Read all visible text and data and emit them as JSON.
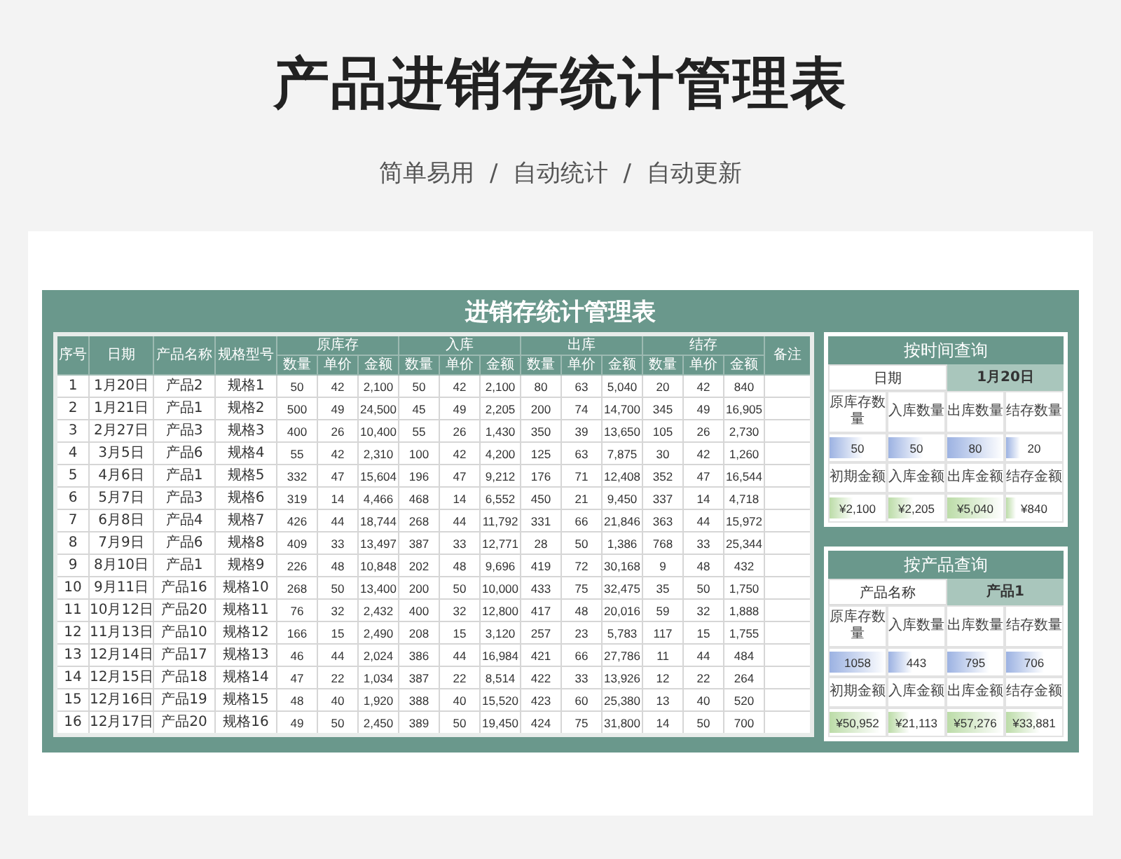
{
  "title": "产品进销存统计管理表",
  "subtitle": "简单易用  /  自动统计  /  自动更新",
  "sheet": {
    "title": "进销存统计管理表",
    "columns": [
      "序号",
      "日期",
      "产品名称",
      "规格型号"
    ],
    "groups": [
      {
        "label": "原库存",
        "sub": [
          "数量",
          "单价",
          "金额"
        ]
      },
      {
        "label": "入库",
        "sub": [
          "数量",
          "单价",
          "金额"
        ]
      },
      {
        "label": "出库",
        "sub": [
          "数量",
          "单价",
          "金额"
        ]
      },
      {
        "label": "结存",
        "sub": [
          "数量",
          "单价",
          "金额"
        ]
      }
    ],
    "note_column": "备注",
    "rows": [
      [
        "1",
        "1月20日",
        "产品2",
        "规格1",
        "50",
        "42",
        "2,100",
        "50",
        "42",
        "2,100",
        "80",
        "63",
        "5,040",
        "20",
        "42",
        "840"
      ],
      [
        "2",
        "1月21日",
        "产品1",
        "规格2",
        "500",
        "49",
        "24,500",
        "45",
        "49",
        "2,205",
        "200",
        "74",
        "14,700",
        "345",
        "49",
        "16,905"
      ],
      [
        "3",
        "2月27日",
        "产品3",
        "规格3",
        "400",
        "26",
        "10,400",
        "55",
        "26",
        "1,430",
        "350",
        "39",
        "13,650",
        "105",
        "26",
        "2,730"
      ],
      [
        "4",
        "3月5日",
        "产品6",
        "规格4",
        "55",
        "42",
        "2,310",
        "100",
        "42",
        "4,200",
        "125",
        "63",
        "7,875",
        "30",
        "42",
        "1,260"
      ],
      [
        "5",
        "4月6日",
        "产品1",
        "规格5",
        "332",
        "47",
        "15,604",
        "196",
        "47",
        "9,212",
        "176",
        "71",
        "12,408",
        "352",
        "47",
        "16,544"
      ],
      [
        "6",
        "5月7日",
        "产品3",
        "规格6",
        "319",
        "14",
        "4,466",
        "468",
        "14",
        "6,552",
        "450",
        "21",
        "9,450",
        "337",
        "14",
        "4,718"
      ],
      [
        "7",
        "6月8日",
        "产品4",
        "规格7",
        "426",
        "44",
        "18,744",
        "268",
        "44",
        "11,792",
        "331",
        "66",
        "21,846",
        "363",
        "44",
        "15,972"
      ],
      [
        "8",
        "7月9日",
        "产品6",
        "规格8",
        "409",
        "33",
        "13,497",
        "387",
        "33",
        "12,771",
        "28",
        "50",
        "1,386",
        "768",
        "33",
        "25,344"
      ],
      [
        "9",
        "8月10日",
        "产品1",
        "规格9",
        "226",
        "48",
        "10,848",
        "202",
        "48",
        "9,696",
        "419",
        "72",
        "30,168",
        "9",
        "48",
        "432"
      ],
      [
        "10",
        "9月11日",
        "产品16",
        "规格10",
        "268",
        "50",
        "13,400",
        "200",
        "50",
        "10,000",
        "433",
        "75",
        "32,475",
        "35",
        "50",
        "1,750"
      ],
      [
        "11",
        "10月12日",
        "产品20",
        "规格11",
        "76",
        "32",
        "2,432",
        "400",
        "32",
        "12,800",
        "417",
        "48",
        "20,016",
        "59",
        "32",
        "1,888"
      ],
      [
        "12",
        "11月13日",
        "产品10",
        "规格12",
        "166",
        "15",
        "2,490",
        "208",
        "15",
        "3,120",
        "257",
        "23",
        "5,783",
        "117",
        "15",
        "1,755"
      ],
      [
        "13",
        "12月14日",
        "产品17",
        "规格13",
        "46",
        "44",
        "2,024",
        "386",
        "44",
        "16,984",
        "421",
        "66",
        "27,786",
        "11",
        "44",
        "484"
      ],
      [
        "14",
        "12月15日",
        "产品18",
        "规格14",
        "47",
        "22",
        "1,034",
        "387",
        "22",
        "8,514",
        "422",
        "33",
        "13,926",
        "12",
        "22",
        "264"
      ],
      [
        "15",
        "12月16日",
        "产品19",
        "规格15",
        "48",
        "40",
        "1,920",
        "388",
        "40",
        "15,520",
        "423",
        "60",
        "25,380",
        "13",
        "40",
        "520"
      ],
      [
        "16",
        "12月17日",
        "产品20",
        "规格16",
        "49",
        "50",
        "2,450",
        "389",
        "50",
        "19,450",
        "424",
        "75",
        "31,800",
        "14",
        "50",
        "700"
      ]
    ]
  },
  "panels": [
    {
      "title": "按时间查询",
      "key_label": "日期",
      "key_value": "1月20日",
      "qty_labels": [
        "原库存数量",
        "入库数量",
        "出库数量",
        "结存数量"
      ],
      "qty": [
        {
          "value": "50",
          "level": 0.6
        },
        {
          "value": "50",
          "level": 0.62
        },
        {
          "value": "80",
          "level": 1
        },
        {
          "value": "20",
          "level": 0.25
        }
      ],
      "amt_labels": [
        "初期金额",
        "入库金额",
        "出库金额",
        "结存金额"
      ],
      "amt": [
        {
          "value": "¥2,100",
          "level": 0.42
        },
        {
          "value": "¥2,205",
          "level": 0.44
        },
        {
          "value": "¥5,040",
          "level": 1
        },
        {
          "value": "¥840",
          "level": 0.17
        }
      ]
    },
    {
      "title": "按产品查询",
      "key_label": "产品名称",
      "key_value": "产品1",
      "qty_labels": [
        "原库存数量",
        "入库数量",
        "出库数量",
        "结存数量"
      ],
      "qty": [
        {
          "value": "1058",
          "level": 1
        },
        {
          "value": "443",
          "level": 0.42
        },
        {
          "value": "795",
          "level": 0.75
        },
        {
          "value": "706",
          "level": 0.67
        }
      ],
      "amt_labels": [
        "初期金额",
        "入库金额",
        "出库金额",
        "结存金额"
      ],
      "amt": [
        {
          "value": "¥50,952",
          "level": 0.89
        },
        {
          "value": "¥21,113",
          "level": 0.37
        },
        {
          "value": "¥57,276",
          "level": 1
        },
        {
          "value": "¥33,881",
          "level": 0.59
        }
      ]
    }
  ]
}
